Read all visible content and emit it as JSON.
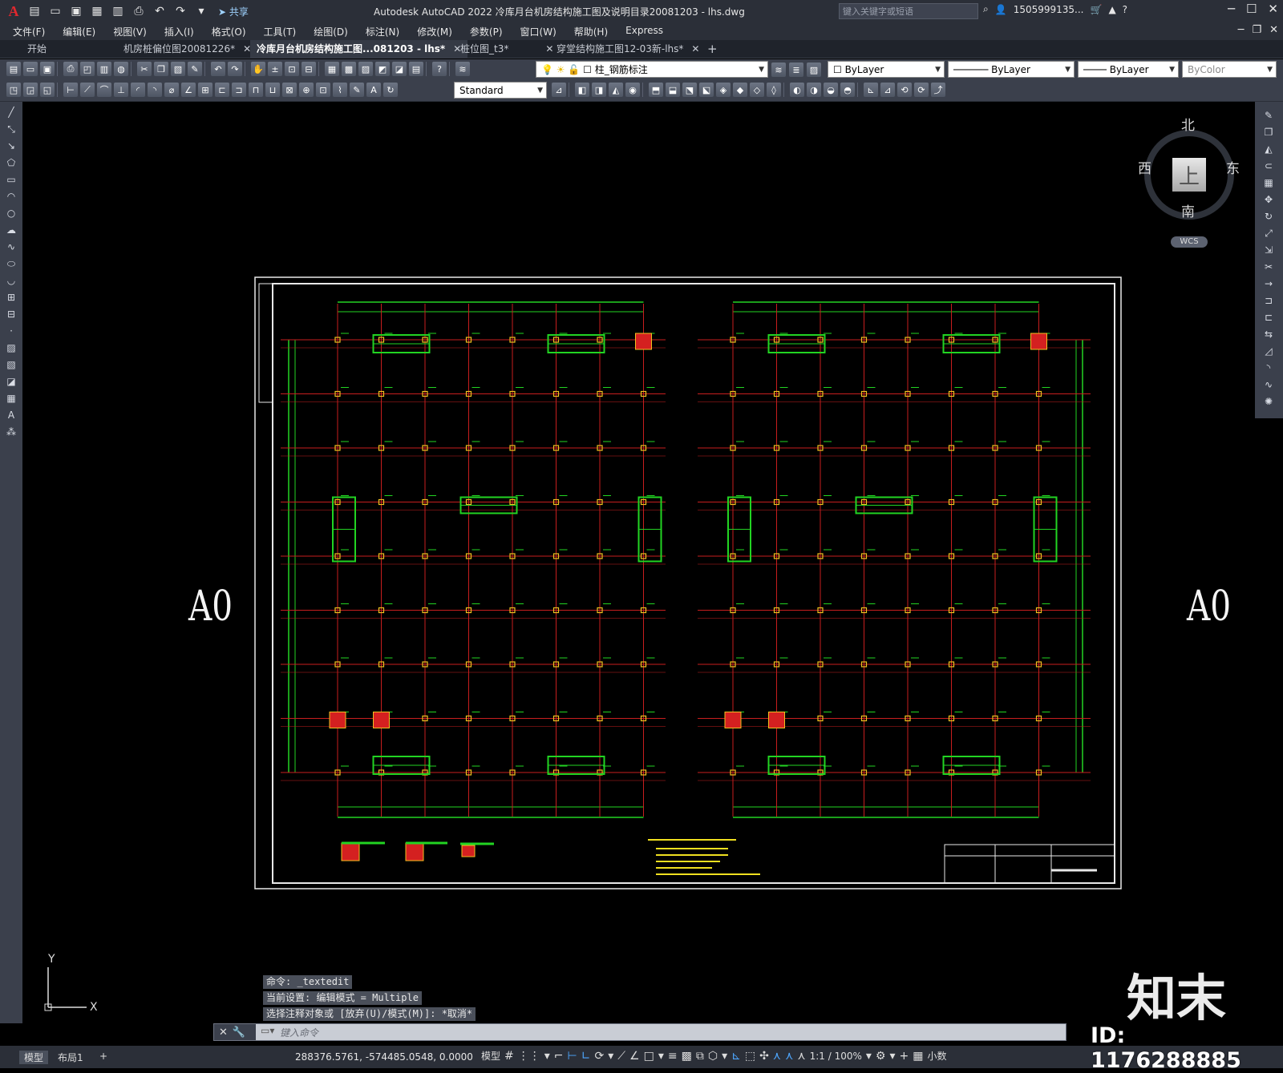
{
  "window": {
    "title": "Autodesk AutoCAD 2022    冷库月台机房结构施工图及说明目录20081203 - lhs.dwg",
    "share_label": "共享",
    "search_placeholder": "键入关键字或短语",
    "user": "1505999135...",
    "help": "?"
  },
  "menu": [
    "文件(F)",
    "编辑(E)",
    "视图(V)",
    "插入(I)",
    "格式(O)",
    "工具(T)",
    "绘图(D)",
    "标注(N)",
    "修改(M)",
    "参数(P)",
    "窗口(W)",
    "帮助(H)",
    "Express"
  ],
  "tabs": [
    {
      "label": "开始",
      "closable": false
    },
    {
      "label": "机房桩偏位图20081226*",
      "closable": true
    },
    {
      "label": "冷库月台机房结构施工图...081203 - lhs*",
      "closable": true,
      "active": true
    },
    {
      "label": "桩位图_t3*",
      "closable": true
    },
    {
      "label": "穿堂结构施工图12-03新-lhs*",
      "closable": true
    }
  ],
  "toolbar": {
    "layer": "柱_钢筋标注",
    "color": "ByLayer",
    "linetype": "ByLayer",
    "lineweight": "ByLayer",
    "plotstyle": "ByColor",
    "textstyle": "Standard"
  },
  "viewcube": {
    "top": "上",
    "north": "北",
    "south": "南",
    "west": "西",
    "east": "东",
    "wcs": "WCS"
  },
  "canvas": {
    "sheet_left": "A0",
    "sheet_right": "A0"
  },
  "ucs": {
    "y": "Y",
    "x": "X"
  },
  "command": {
    "history": [
      "命令: _textedit",
      "当前设置: 编辑模式 = Multiple",
      "选择注释对象或 [放弃(U)/模式(M)]: *取消*"
    ],
    "placeholder": "键入命令"
  },
  "status": {
    "tab_model": "模型",
    "tab_layout": "布局1",
    "coords": "288376.5761, -574485.0548, 0.0000",
    "space": "模型",
    "scale": "1:1 / 100%",
    "units": "小数"
  },
  "watermark": {
    "brand": "知末",
    "id": "ID: 1176288885"
  }
}
